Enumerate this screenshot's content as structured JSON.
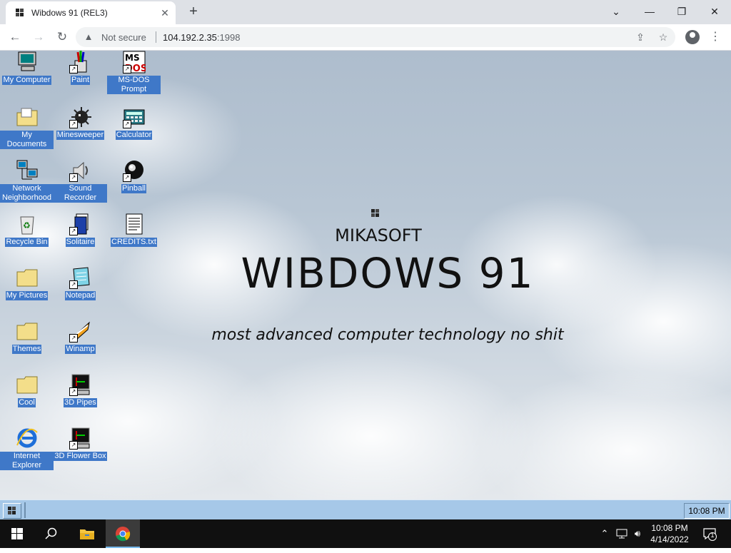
{
  "browser": {
    "tab_title": "Wibdows 91 (REL3)",
    "security_label": "Not secure",
    "url_host": "104.192.2.35",
    "url_port": ":1998"
  },
  "desktop": {
    "icons": [
      {
        "label": "My Computer",
        "icon": "computer-icon"
      },
      {
        "label": "Paint",
        "icon": "paint-icon"
      },
      {
        "label": "MS-DOS Prompt",
        "icon": "msdos-icon"
      },
      {
        "label": "My Documents",
        "icon": "folder-documents-icon"
      },
      {
        "label": "Minesweeper",
        "icon": "mine-icon"
      },
      {
        "label": "Calculator",
        "icon": "calculator-icon"
      },
      {
        "label": "Network Neighborhood",
        "icon": "network-icon"
      },
      {
        "label": "Sound Recorder",
        "icon": "speaker-icon"
      },
      {
        "label": "Pinball",
        "icon": "pinball-icon"
      },
      {
        "label": "Recycle Bin",
        "icon": "recycle-bin-icon"
      },
      {
        "label": "Solitaire",
        "icon": "cards-icon"
      },
      {
        "label": "CREDITS.txt",
        "icon": "text-file-icon"
      },
      {
        "label": "My Pictures",
        "icon": "folder-icon"
      },
      {
        "label": "Notepad",
        "icon": "notepad-icon"
      },
      {
        "label": "Themes",
        "icon": "folder-icon"
      },
      {
        "label": "Winamp",
        "icon": "winamp-icon"
      },
      {
        "label": "Cool",
        "icon": "folder-icon"
      },
      {
        "label": "3D Pipes",
        "icon": "screensaver-icon"
      },
      {
        "label": "Internet Explorer",
        "icon": "ie-icon"
      },
      {
        "label": "3D Flower Box",
        "icon": "screensaver-icon"
      }
    ],
    "brand": {
      "company": "MIKASOFT",
      "title": "WIBDOWS 91",
      "tagline": "most advanced computer technology no shit"
    }
  },
  "w9_taskbar": {
    "clock": "10:08 PM"
  },
  "taskbar": {
    "time": "10:08 PM",
    "date": "4/14/2022",
    "notification_count": "1"
  }
}
